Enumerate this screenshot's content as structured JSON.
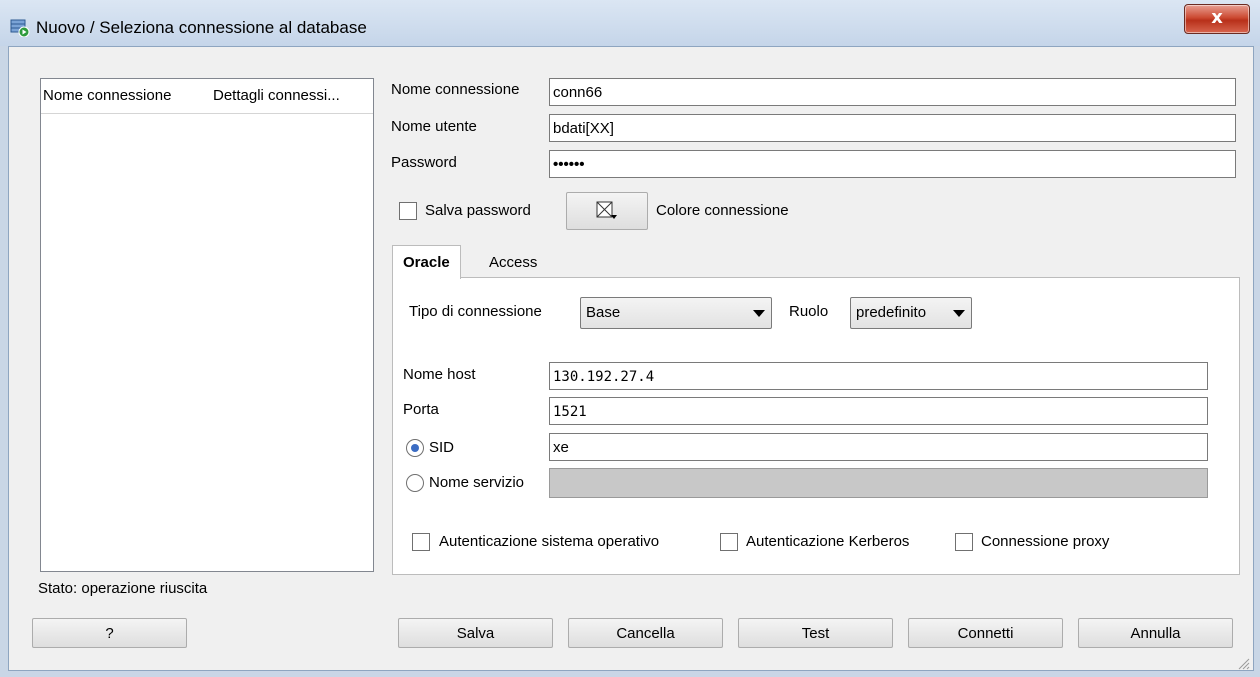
{
  "window": {
    "title": "Nuovo / Seleziona connessione al database",
    "close_glyph": "x",
    "icon": "database-connect-icon"
  },
  "connections_list": {
    "columns": [
      "Nome connessione",
      "Dettagli connessi..."
    ]
  },
  "form": {
    "name_label": "Nome connessione",
    "name_value": "conn66",
    "user_label": "Nome utente",
    "user_value": "bdati[XX]",
    "password_label": "Password",
    "password_value": "••••••",
    "save_password_label": "Salva password",
    "save_password_checked": false,
    "color_label": "Colore connessione"
  },
  "tabs": [
    {
      "label": "Oracle",
      "active": true
    },
    {
      "label": "Access",
      "active": false
    }
  ],
  "oracle": {
    "conn_type_label": "Tipo di connessione",
    "conn_type_value": "Base",
    "role_label": "Ruolo",
    "role_value": "predefinito",
    "host_label": "Nome host",
    "host_value": "130.192.27.4",
    "port_label": "Porta",
    "port_value": "1521",
    "sid_label": "SID",
    "sid_value": "xe",
    "service_label": "Nome servizio",
    "service_value": "",
    "os_auth_label": "Autenticazione sistema operativo",
    "kerberos_label": "Autenticazione Kerberos",
    "proxy_label": "Connessione proxy"
  },
  "status": {
    "text": "Stato: operazione riuscita"
  },
  "buttons": {
    "help": "?",
    "save": "Salva",
    "clear": "Cancella",
    "test": "Test",
    "connect": "Connetti",
    "cancel": "Annulla"
  }
}
